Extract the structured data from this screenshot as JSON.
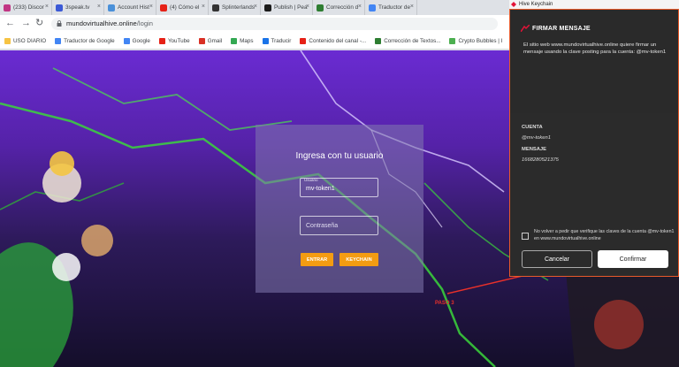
{
  "browser": {
    "tabs": [
      {
        "label": "(233) Discor",
        "icon": "instagram-icon",
        "color": "#c13584"
      },
      {
        "label": "3speak.tv",
        "icon": "3speak-icon",
        "color": "#3c5ad6"
      },
      {
        "label": "Account Hist",
        "icon": "document-icon",
        "color": "#4a90d9"
      },
      {
        "label": "(4) Cómo el",
        "icon": "youtube-icon",
        "color": "#e62117"
      },
      {
        "label": "Splinterlands",
        "icon": "splinterlands-icon",
        "color": "#333333"
      },
      {
        "label": "Publish | Pea",
        "icon": "peakd-icon",
        "color": "#1a1a1a"
      },
      {
        "label": "Corrección d",
        "icon": "check-icon",
        "color": "#2e7d32"
      },
      {
        "label": "Traductor de",
        "icon": "translate-icon",
        "color": "#4285f4"
      }
    ],
    "url_host": "mundovirtualhive.online",
    "url_path": "/login",
    "bookmarks": [
      {
        "label": "USO DIARIO",
        "icon": "folder-icon",
        "color": "#f6c343"
      },
      {
        "label": "Traductor de Google",
        "icon": "translate-icon",
        "color": "#4285f4"
      },
      {
        "label": "Google",
        "icon": "google-icon",
        "color": "#4285f4"
      },
      {
        "label": "YouTube",
        "icon": "youtube-icon",
        "color": "#e62117"
      },
      {
        "label": "Gmail",
        "icon": "gmail-icon",
        "color": "#d93025"
      },
      {
        "label": "Maps",
        "icon": "maps-icon",
        "color": "#34a853"
      },
      {
        "label": "Traducir",
        "icon": "translate-icon",
        "color": "#1a73e8"
      },
      {
        "label": "Contenido del canal -...",
        "icon": "youtube-icon",
        "color": "#e62117"
      },
      {
        "label": "Corrección de Textos...",
        "icon": "check-icon",
        "color": "#2e7d32"
      },
      {
        "label": "Crypto Bubbles | I",
        "icon": "bubbles-icon",
        "color": "#4caf50"
      }
    ]
  },
  "login": {
    "title": "Ingresa con tu usuario",
    "username_label": "Usuario",
    "username_value": "mv-token1",
    "password_placeholder": "Contraseña",
    "enter_button": "ENTRAR",
    "keychain_button": "KEYCHAIN"
  },
  "annotation": {
    "label": "PASO 3",
    "color": "#e8302a"
  },
  "keychain": {
    "window_title": "Hive Keychain",
    "heading": "FIRMAR MENSAJE",
    "description": "El sitio web www.mundovirtualhive.online quiere firmar un mensaje usando la clave posting para la cuenta: @mv-token1",
    "account_label": "CUENTA",
    "account_value": "@mv-token1",
    "message_label": "MENSAJE",
    "message_value": "1668280521375",
    "checkbox_text": "No volver a pedir que verifique las claves de la cuenta @mv-token1 en www.mundovirtualhive.online",
    "cancel_button": "Cancelar",
    "confirm_button": "Confirmar",
    "accent_color": "#e85a2a"
  },
  "colors": {
    "button_orange": "#f39c12",
    "background_purple": "#6a2bd2"
  }
}
